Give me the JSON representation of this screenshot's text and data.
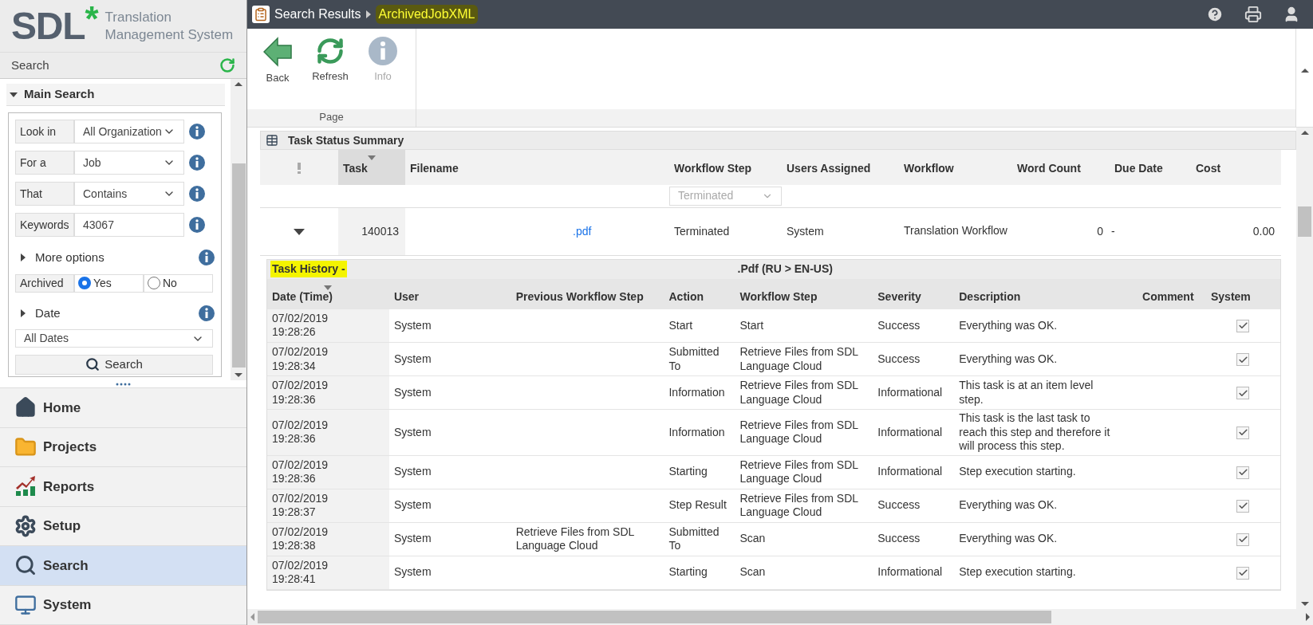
{
  "logo": {
    "word": "SDL",
    "mark": "*",
    "line1": "Translation",
    "line2": "Management System"
  },
  "sidebar": {
    "header": "Search",
    "section": {
      "title": "Main Search",
      "expanded": true
    },
    "fields": [
      {
        "kind": "select",
        "label": "Look in",
        "value": "All Organization"
      },
      {
        "kind": "select",
        "label": "For a",
        "value": "Job"
      },
      {
        "kind": "select",
        "label": "That",
        "value": "Contains"
      },
      {
        "kind": "input",
        "label": "Keywords",
        "value": "43067"
      }
    ],
    "more_options": {
      "label": "More options",
      "expanded": false
    },
    "archived": {
      "label": "Archived",
      "options": [
        {
          "label": "Yes",
          "selected": true
        },
        {
          "label": "No",
          "selected": false
        }
      ]
    },
    "date": {
      "label": "Date",
      "expanded": false,
      "value": "All Dates"
    },
    "search_button": "Search",
    "nav": [
      {
        "label": "Home",
        "selected": false
      },
      {
        "label": "Projects",
        "selected": false
      },
      {
        "label": "Reports",
        "selected": false
      },
      {
        "label": "Setup",
        "selected": false
      },
      {
        "label": "Search",
        "selected": true
      },
      {
        "label": "System",
        "selected": false
      }
    ]
  },
  "breadcrumb": [
    {
      "label": "Search Results",
      "highlighted": false
    },
    {
      "label": "ArchivedJobXML",
      "highlighted": true
    }
  ],
  "toolbar": {
    "buttons": [
      {
        "label": "Back",
        "disabled": false
      },
      {
        "label": "Refresh",
        "disabled": false
      },
      {
        "label": "Info",
        "disabled": true
      }
    ],
    "group": "Page"
  },
  "summary": {
    "title": "Task Status Summary",
    "columns": [
      {
        "label": "Task",
        "sorted": true
      },
      {
        "label": "Filename",
        "sorted": false
      },
      {
        "label": "Workflow Step",
        "sorted": false
      },
      {
        "label": "Users Assigned",
        "sorted": false
      },
      {
        "label": "Workflow",
        "sorted": false
      },
      {
        "label": "Word Count",
        "sorted": false
      },
      {
        "label": "Due Date",
        "sorted": false
      },
      {
        "label": "Cost",
        "sorted": false
      }
    ],
    "filter": {
      "value": "Terminated",
      "disabled": true
    },
    "row": {
      "expanded": true,
      "task": "140013",
      "filename": ".pdf",
      "workflow_step": "Terminated",
      "users": "System",
      "workflow": "Translation Workflow",
      "word_count": "0",
      "due_date": "-",
      "cost": "0.00"
    }
  },
  "history": {
    "title": {
      "label": "Task History -",
      "highlighted": true
    },
    "suffix": ".Pdf (RU > EN-US)",
    "columns": [
      {
        "label": "Date (Time)",
        "sorted": true
      },
      {
        "label": "User",
        "sorted": false
      },
      {
        "label": "Previous Workflow Step",
        "sorted": false
      },
      {
        "label": "Action",
        "sorted": false
      },
      {
        "label": "Workflow Step",
        "sorted": false
      },
      {
        "label": "Severity",
        "sorted": false
      },
      {
        "label": "Description",
        "sorted": false
      },
      {
        "label": "Comment",
        "sorted": false
      },
      {
        "label": "System",
        "sorted": false
      }
    ],
    "rows": [
      {
        "date": "07/02/2019",
        "time": "19:28:26",
        "user": "System",
        "previous": "",
        "action": "Start",
        "step": "Start",
        "severity": "Success",
        "description": "Everything was OK.",
        "system": true
      },
      {
        "date": "07/02/2019",
        "time": "19:28:34",
        "user": "System",
        "previous": "",
        "action": "Submitted To",
        "step": "Retrieve Files from SDL Language Cloud",
        "severity": "Success",
        "description": "Everything was OK.",
        "system": true
      },
      {
        "date": "07/02/2019",
        "time": "19:28:36",
        "user": "System",
        "previous": "",
        "action": "Information",
        "step": "Retrieve Files from SDL Language Cloud",
        "severity": "Informational",
        "description": "This task is at an item level step.",
        "system": true
      },
      {
        "date": "07/02/2019",
        "time": "19:28:36",
        "user": "System",
        "previous": "",
        "action": "Information",
        "step": "Retrieve Files from SDL Language Cloud",
        "severity": "Informational",
        "description": "This task is the last task to reach this step and therefore it will process this step.",
        "system": true
      },
      {
        "date": "07/02/2019",
        "time": "19:28:36",
        "user": "System",
        "previous": "",
        "action": "Starting",
        "step": "Retrieve Files from SDL Language Cloud",
        "severity": "Informational",
        "description": "Step execution starting.",
        "system": true
      },
      {
        "date": "07/02/2019",
        "time": "19:28:37",
        "user": "System",
        "previous": "",
        "action": "Step Result",
        "step": "Retrieve Files from SDL Language Cloud",
        "severity": "Success",
        "description": "Everything was OK.",
        "system": true
      },
      {
        "date": "07/02/2019",
        "time": "19:28:38",
        "user": "System",
        "previous": "Retrieve Files from SDL Language Cloud",
        "action": "Submitted To",
        "step": "Scan",
        "severity": "Success",
        "description": "Everything was OK.",
        "system": true
      },
      {
        "date": "07/02/2019",
        "time": "19:28:41",
        "user": "System",
        "previous": "",
        "action": "Starting",
        "step": "Scan",
        "severity": "Informational",
        "description": "Step execution starting.",
        "system": true
      }
    ]
  }
}
